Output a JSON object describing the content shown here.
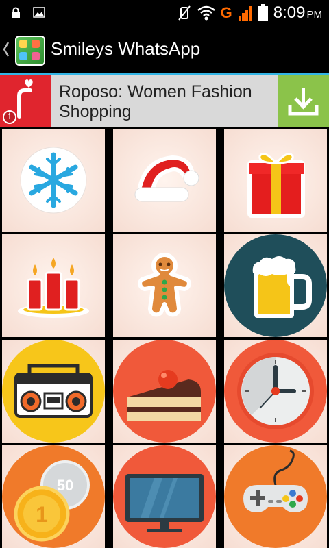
{
  "status_bar": {
    "time": "8:09",
    "ampm": "PM",
    "network_label": "G"
  },
  "action_bar": {
    "title": "Smileys WhatsApp"
  },
  "ad": {
    "title": "Roposo: Women Fashion Shopping",
    "logo_icon": "roposo-logo-icon",
    "info_label": "i"
  },
  "grid": {
    "items": [
      {
        "icon": "snowflake-icon"
      },
      {
        "icon": "santa-hat-icon"
      },
      {
        "icon": "gift-box-icon"
      },
      {
        "icon": "candles-icon"
      },
      {
        "icon": "gingerbread-man-icon"
      },
      {
        "icon": "beer-mug-icon"
      },
      {
        "icon": "boombox-icon"
      },
      {
        "icon": "cake-slice-icon"
      },
      {
        "icon": "clock-icon"
      },
      {
        "icon": "coins-icon"
      },
      {
        "icon": "tv-monitor-icon"
      },
      {
        "icon": "game-controller-icon"
      }
    ],
    "coin_front_label": "1",
    "coin_back_label": "50"
  },
  "colors": {
    "accent": "#33b5e5",
    "ad_red": "#e0252e",
    "ad_green": "#8bc34a"
  }
}
